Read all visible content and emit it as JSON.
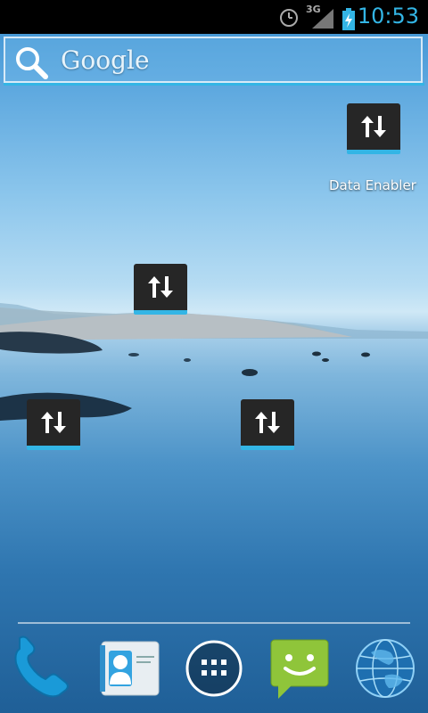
{
  "status_bar": {
    "network_type": "3G",
    "time": "10:53",
    "icons": [
      "alarm-icon",
      "signal-icon",
      "battery-charging-icon"
    ],
    "accent_color": "#33b5e5"
  },
  "search_bar": {
    "label": "Google",
    "icon": "search-icon"
  },
  "widgets": [
    {
      "label": "Data Enabler",
      "icon": "data-toggle-icon"
    },
    {
      "label": "",
      "icon": "data-toggle-icon"
    },
    {
      "label": "",
      "icon": "data-toggle-icon"
    },
    {
      "label": "",
      "icon": "data-toggle-icon"
    }
  ],
  "dock": {
    "items": [
      {
        "name": "Phone",
        "icon": "phone-icon"
      },
      {
        "name": "Contacts",
        "icon": "contacts-icon",
        "card_text": "Lauren Ipsum"
      },
      {
        "name": "Apps",
        "icon": "app-drawer-icon"
      },
      {
        "name": "Messaging",
        "icon": "messaging-icon"
      },
      {
        "name": "Browser",
        "icon": "globe-icon"
      }
    ]
  }
}
